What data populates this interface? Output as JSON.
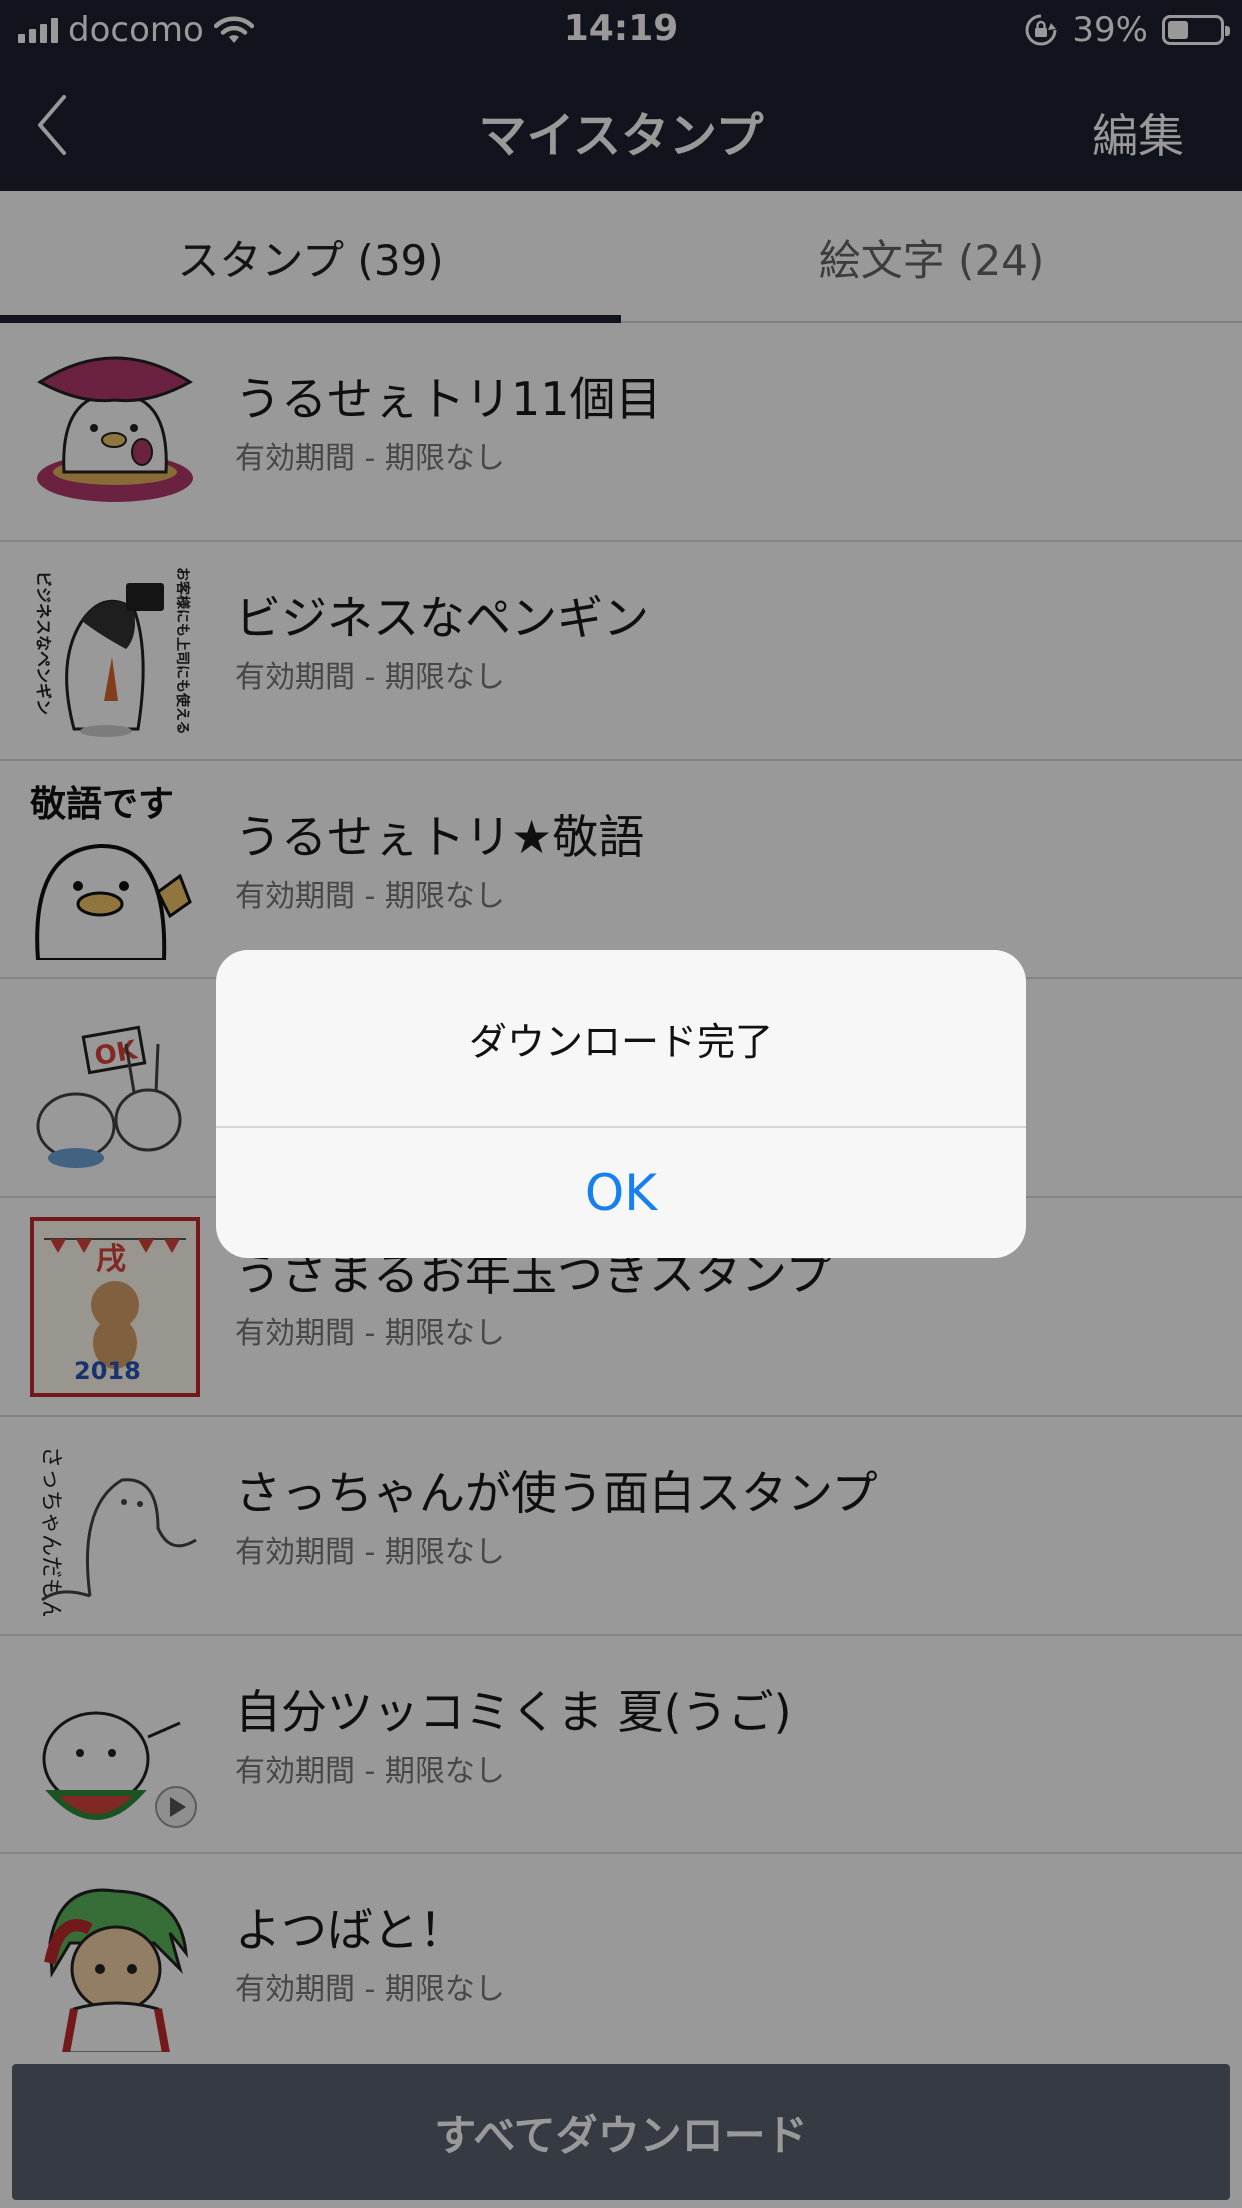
{
  "status_bar": {
    "carrier": "docomo",
    "time": "14:19",
    "battery_percent": "39%",
    "battery_level": 0.39,
    "icons": [
      "signal-icon",
      "wifi-icon",
      "rotation-lock-icon",
      "battery-icon"
    ]
  },
  "nav": {
    "title": "マイスタンプ",
    "edit_label": "編集",
    "back_icon": "chevron-left-icon"
  },
  "tabs": [
    {
      "label": "スタンプ (39)",
      "active": true
    },
    {
      "label": "絵文字 (24)",
      "active": false
    }
  ],
  "stickers": [
    {
      "title": "うるせぇトリ11個目",
      "validity": "有効期間 - 期限なし",
      "thumb": "bird-on-sweet-potato"
    },
    {
      "title": "ビジネスなペンギン",
      "validity": "有効期間 - 期限なし",
      "thumb": "business-penguin"
    },
    {
      "title": "うるせぇトリ★敬語",
      "validity": "有効期間 - 期限なし",
      "thumb": "bird-keigo"
    },
    {
      "title": "",
      "validity": "",
      "thumb": "ok-sign-animals"
    },
    {
      "title": "うさまるお年玉つきスタンプ",
      "validity": "有効期間 - 期限なし",
      "thumb": "usamaru-new-year"
    },
    {
      "title": "さっちゃんが使う面白スタンプ",
      "validity": "有効期間 - 期限なし",
      "thumb": "sacchan-bear"
    },
    {
      "title": "自分ツッコミくま 夏(うご)",
      "validity": "有効期間 - 期限なし",
      "thumb": "bear-watermelon"
    },
    {
      "title": "よつばと！",
      "validity": "有効期間 - 期限なし",
      "thumb": "yotsuba"
    }
  ],
  "bottom": {
    "download_all_label": "すべてダウンロード"
  },
  "dialog": {
    "message": "ダウンロード完了",
    "ok_label": "OK"
  },
  "thumb_texts": {
    "keigo": "敬語です",
    "ok_sign": "OK",
    "year_kanji": "戌",
    "year_digits": "2018",
    "sacchan": "さっちゃんだもん",
    "penguin_side": "ビジネスなペンギン",
    "penguin_tagline": "お客様にも上司にも使える"
  },
  "colors": {
    "header_bg": "#1d2230",
    "accent_blue": "#1680f0",
    "download_button": "#5a6170"
  }
}
